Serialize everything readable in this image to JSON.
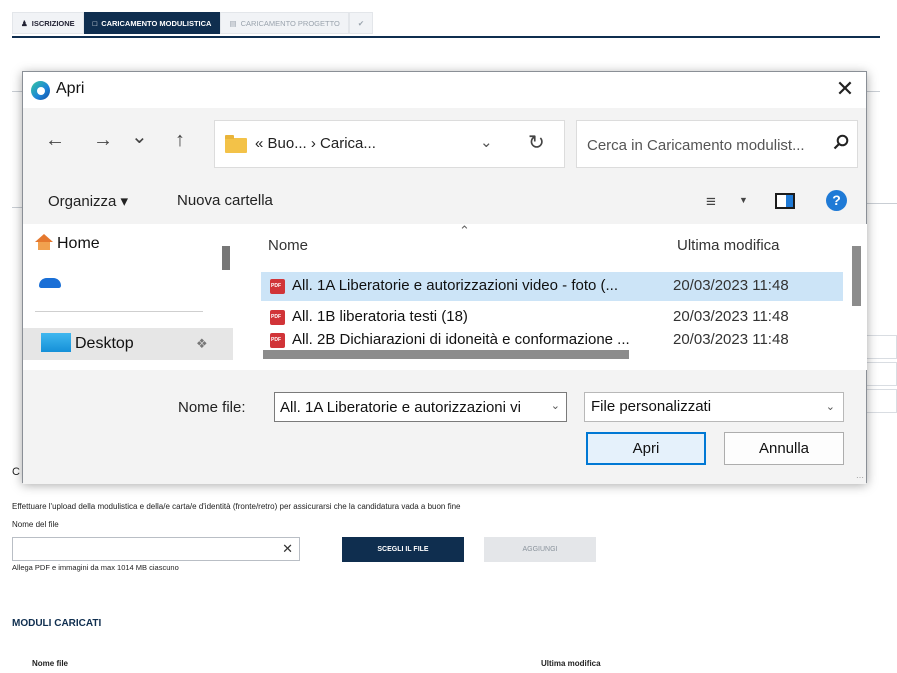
{
  "page": {
    "tabs": [
      {
        "label": "ISCRIZIONE",
        "icon": "user-icon",
        "state": "done"
      },
      {
        "label": "CARICAMENTO MODULISTICA",
        "icon": "folder-icon",
        "state": "active"
      },
      {
        "label": "CARICAMENTO PROGETTO",
        "icon": "project-icon",
        "state": "disabled"
      },
      {
        "label": "✔",
        "icon": "check-icon",
        "state": "disabled"
      }
    ],
    "section_letter": "C",
    "instructions": "Effettuare l'upload della modulistica e della/e carta/e d'identità (fronte/retro) per assicurarsi che la candidatura vada a buon fine",
    "file_name_label": "Nome del file",
    "file_name_value": "",
    "clear_symbol": "✕",
    "choose_button": "SCEGLI IL FILE",
    "add_button": "AGGIUNGI",
    "hint": "Allega PDF e immagini da max 1014 MB ciascuno",
    "uploaded_title": "MODULI CARICATI",
    "uploaded_columns": [
      "Nome file",
      "Ultima modifica"
    ]
  },
  "dialog": {
    "title": "Apri",
    "close_symbol": "✕",
    "nav": {
      "back": "←",
      "forward": "→",
      "recent": "⌄",
      "up": "↑"
    },
    "address": {
      "path_prefix": "«",
      "segments": [
        "Buo...",
        "Carica..."
      ],
      "separator": "›",
      "text": "«  Buo...  ›  Carica..."
    },
    "search_placeholder": "Cerca in Caricamento modulist...",
    "toolbar": {
      "organize": "Organizza ▾",
      "new_folder": "Nuova cartella"
    },
    "sidebar": [
      {
        "label": "Home",
        "icon": "home-icon"
      },
      {
        "label": "",
        "icon": "onedrive-cloud-icon"
      },
      {
        "label": "Desktop",
        "icon": "desktop-icon",
        "selected": true
      }
    ],
    "columns": {
      "name": "Nome",
      "modified": "Ultima modifica"
    },
    "files": [
      {
        "name": "All. 1A Liberatorie e autorizzazioni video - foto (...",
        "modified": "20/03/2023 11:48",
        "selected": true
      },
      {
        "name": "All. 1B liberatoria testi (18)",
        "modified": "20/03/2023 11:48",
        "selected": false
      },
      {
        "name": "All. 2B Dichiarazioni di idoneità e conformazione ...",
        "modified": "20/03/2023 11:48",
        "selected": false
      }
    ],
    "filename_label": "Nome file:",
    "filename_value": "All. 1A Liberatorie e autorizzazioni vi",
    "filetype": "File personalizzati",
    "open_button": "Apri",
    "cancel_button": "Annulla"
  }
}
